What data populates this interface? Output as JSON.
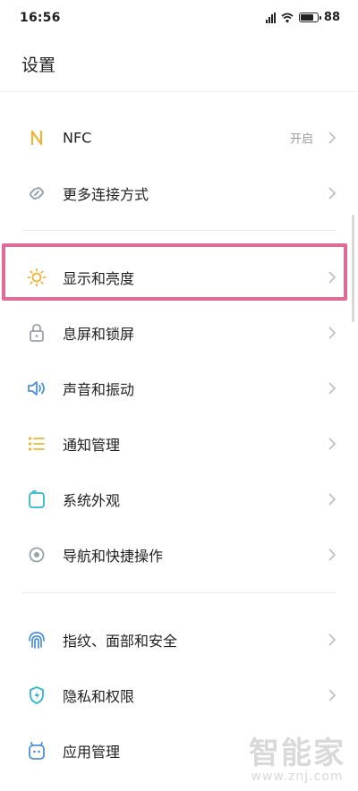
{
  "status_bar": {
    "time": "16:56",
    "battery": "88",
    "battery_level": 0.88
  },
  "header": {
    "title": "设置"
  },
  "groups": [
    {
      "items": [
        {
          "label": "NFC",
          "value": "开启",
          "icon": "nfc-icon"
        },
        {
          "label": "更多连接方式",
          "value": "",
          "icon": "link-icon"
        }
      ]
    },
    {
      "items": [
        {
          "label": "显示和亮度",
          "icon": "sun-icon",
          "highlighted": true
        },
        {
          "label": "息屏和锁屏",
          "icon": "lock-icon"
        },
        {
          "label": "声音和振动",
          "icon": "speaker-icon"
        },
        {
          "label": "通知管理",
          "icon": "list-icon"
        },
        {
          "label": "系统外观",
          "icon": "theme-icon"
        },
        {
          "label": "导航和快捷操作",
          "icon": "navigation-icon"
        }
      ]
    },
    {
      "items": [
        {
          "label": "指纹、面部和安全",
          "icon": "fingerprint-icon"
        },
        {
          "label": "隐私和权限",
          "icon": "shield-icon"
        },
        {
          "label": "应用管理",
          "icon": "app-icon"
        }
      ]
    }
  ],
  "watermark": {
    "logo": "智能家",
    "url": "www.znj.com"
  },
  "colors": {
    "highlight": "#e06b98",
    "orange": "#f2b233",
    "blue": "#4a90d9",
    "cyan": "#2fb8c9"
  }
}
